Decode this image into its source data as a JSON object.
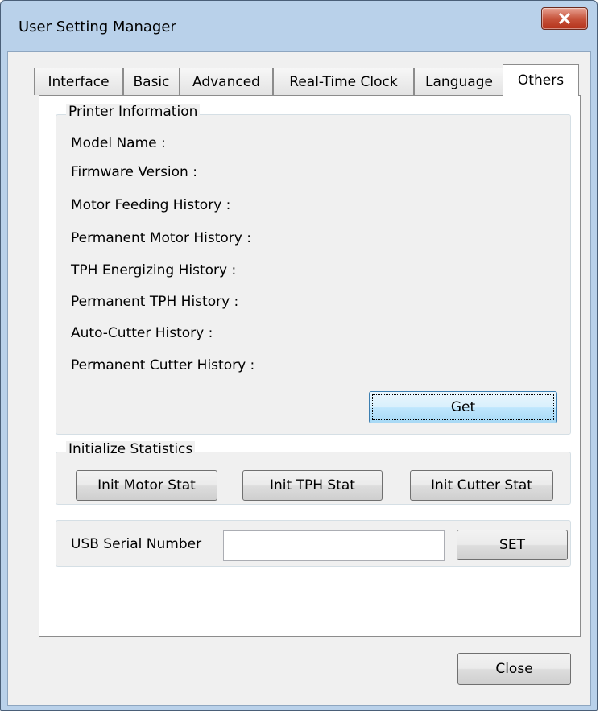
{
  "window": {
    "title": "User Setting Manager",
    "close_icon": "close-x-icon"
  },
  "tabs": [
    {
      "label": "Interface",
      "active": false
    },
    {
      "label": "Basic",
      "active": false
    },
    {
      "label": "Advanced",
      "active": false
    },
    {
      "label": "Real-Time Clock",
      "active": false
    },
    {
      "label": "Language",
      "active": false
    },
    {
      "label": "Others",
      "active": true
    }
  ],
  "printer_info": {
    "legend": "Printer Information",
    "labels": [
      "Model Name :",
      "Firmware Version :",
      "Motor Feeding History :",
      "Permanent Motor History :",
      "TPH Energizing History :",
      "Permanent TPH History :",
      "Auto-Cutter History :",
      "Permanent Cutter History :"
    ],
    "get_label": "Get"
  },
  "init_stats": {
    "legend": "Initialize Statistics",
    "motor_label": "Init Motor Stat",
    "tph_label": "Init TPH Stat",
    "cutter_label": "Init Cutter Stat"
  },
  "usb": {
    "label": "USB Serial Number",
    "value": "",
    "set_label": "SET"
  },
  "footer": {
    "close_label": "Close"
  },
  "colors": {
    "titlebar": "#b9d1ea",
    "close_button": "#c7543c",
    "focus": "#3c7fb1"
  }
}
